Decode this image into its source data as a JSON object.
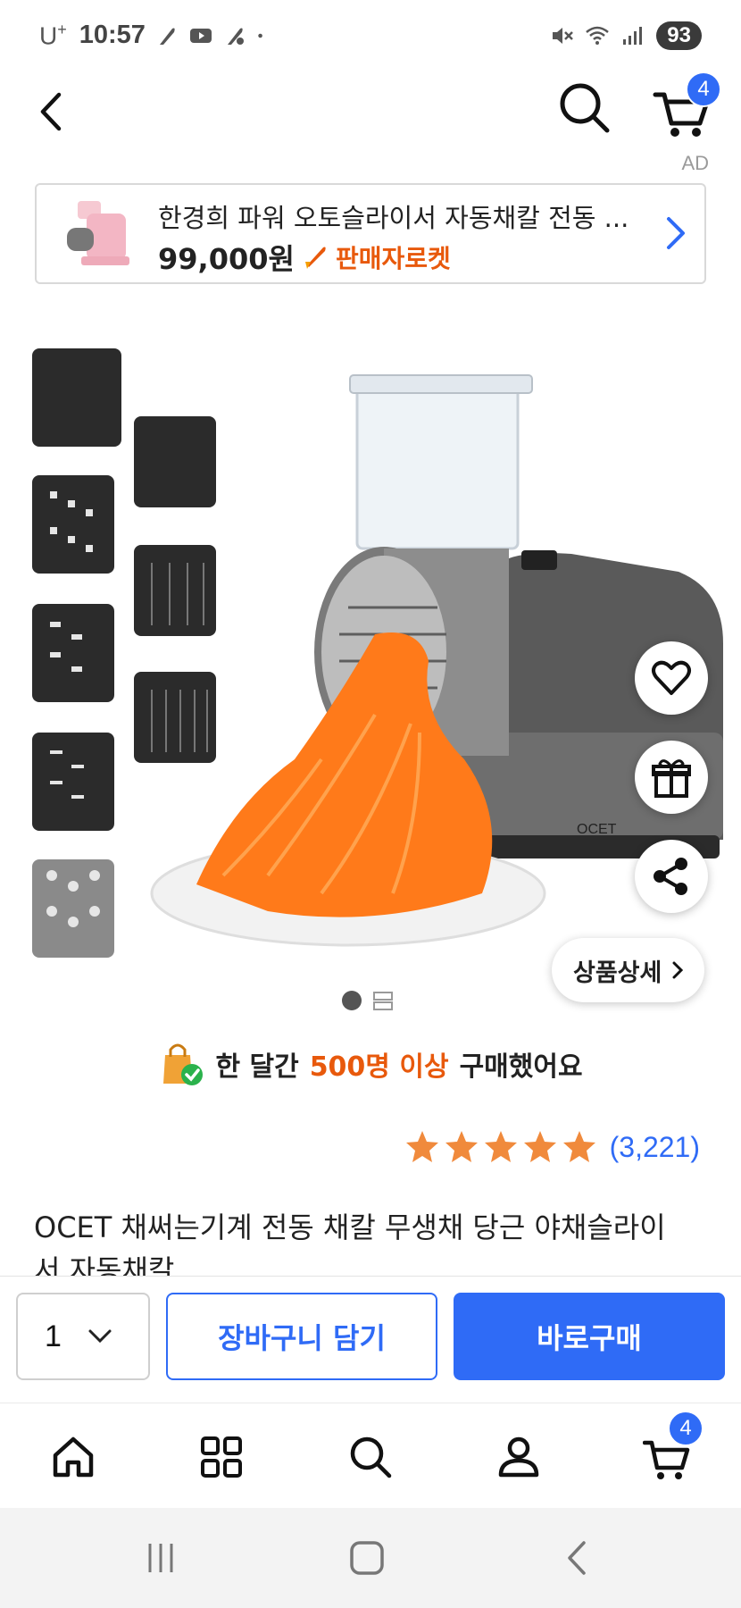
{
  "status_bar": {
    "carrier": "U",
    "carrier_sup": "+",
    "time": "10:57",
    "battery": "93"
  },
  "header": {
    "cart_count": "4"
  },
  "ad": {
    "label": "AD",
    "title": "한경희 파워 오토슬라이서 자동채칼 전동 ...",
    "price": "99,000원",
    "badge": "판매자로켓"
  },
  "product_image": {
    "brand_mark": "OCET",
    "detail_button": "상품상세"
  },
  "sales": {
    "prefix": "한 달간",
    "highlight": "500명 이상",
    "suffix": "구매했어요"
  },
  "rating": {
    "stars": 5,
    "review_count": "(3,221)"
  },
  "product": {
    "title": "OCET 채써는기계 전동 채칼 무생채 당근 야채슬라이서 자동채칼"
  },
  "purchase": {
    "quantity": "1",
    "add_to_cart": "장바구니 담기",
    "buy_now": "바로구매"
  },
  "bottom_nav": {
    "cart_count": "4"
  },
  "colors": {
    "accent": "#2f6bf6",
    "rocket": "#e8590c",
    "star": "#f08a3c"
  }
}
